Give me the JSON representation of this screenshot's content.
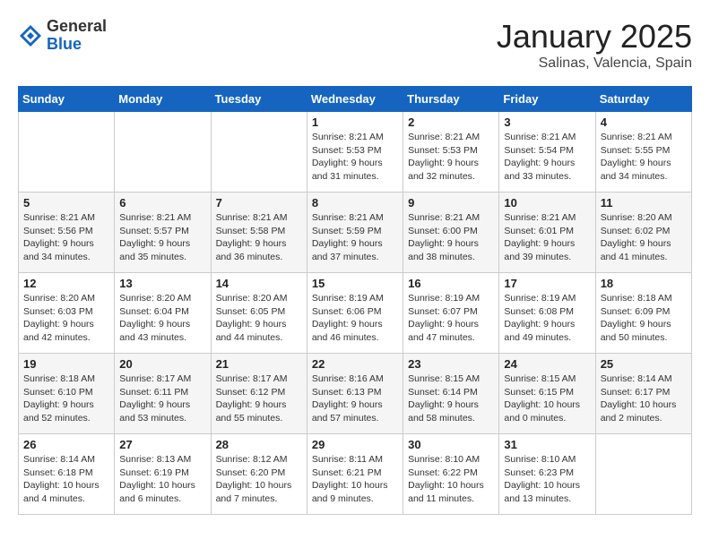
{
  "logo": {
    "general": "General",
    "blue": "Blue"
  },
  "title": "January 2025",
  "subtitle": "Salinas, Valencia, Spain",
  "days_of_week": [
    "Sunday",
    "Monday",
    "Tuesday",
    "Wednesday",
    "Thursday",
    "Friday",
    "Saturday"
  ],
  "weeks": [
    [
      {
        "day": "",
        "info": ""
      },
      {
        "day": "",
        "info": ""
      },
      {
        "day": "",
        "info": ""
      },
      {
        "day": "1",
        "info": "Sunrise: 8:21 AM\nSunset: 5:53 PM\nDaylight: 9 hours and 31 minutes."
      },
      {
        "day": "2",
        "info": "Sunrise: 8:21 AM\nSunset: 5:53 PM\nDaylight: 9 hours and 32 minutes."
      },
      {
        "day": "3",
        "info": "Sunrise: 8:21 AM\nSunset: 5:54 PM\nDaylight: 9 hours and 33 minutes."
      },
      {
        "day": "4",
        "info": "Sunrise: 8:21 AM\nSunset: 5:55 PM\nDaylight: 9 hours and 34 minutes."
      }
    ],
    [
      {
        "day": "5",
        "info": "Sunrise: 8:21 AM\nSunset: 5:56 PM\nDaylight: 9 hours and 34 minutes."
      },
      {
        "day": "6",
        "info": "Sunrise: 8:21 AM\nSunset: 5:57 PM\nDaylight: 9 hours and 35 minutes."
      },
      {
        "day": "7",
        "info": "Sunrise: 8:21 AM\nSunset: 5:58 PM\nDaylight: 9 hours and 36 minutes."
      },
      {
        "day": "8",
        "info": "Sunrise: 8:21 AM\nSunset: 5:59 PM\nDaylight: 9 hours and 37 minutes."
      },
      {
        "day": "9",
        "info": "Sunrise: 8:21 AM\nSunset: 6:00 PM\nDaylight: 9 hours and 38 minutes."
      },
      {
        "day": "10",
        "info": "Sunrise: 8:21 AM\nSunset: 6:01 PM\nDaylight: 9 hours and 39 minutes."
      },
      {
        "day": "11",
        "info": "Sunrise: 8:20 AM\nSunset: 6:02 PM\nDaylight: 9 hours and 41 minutes."
      }
    ],
    [
      {
        "day": "12",
        "info": "Sunrise: 8:20 AM\nSunset: 6:03 PM\nDaylight: 9 hours and 42 minutes."
      },
      {
        "day": "13",
        "info": "Sunrise: 8:20 AM\nSunset: 6:04 PM\nDaylight: 9 hours and 43 minutes."
      },
      {
        "day": "14",
        "info": "Sunrise: 8:20 AM\nSunset: 6:05 PM\nDaylight: 9 hours and 44 minutes."
      },
      {
        "day": "15",
        "info": "Sunrise: 8:19 AM\nSunset: 6:06 PM\nDaylight: 9 hours and 46 minutes."
      },
      {
        "day": "16",
        "info": "Sunrise: 8:19 AM\nSunset: 6:07 PM\nDaylight: 9 hours and 47 minutes."
      },
      {
        "day": "17",
        "info": "Sunrise: 8:19 AM\nSunset: 6:08 PM\nDaylight: 9 hours and 49 minutes."
      },
      {
        "day": "18",
        "info": "Sunrise: 8:18 AM\nSunset: 6:09 PM\nDaylight: 9 hours and 50 minutes."
      }
    ],
    [
      {
        "day": "19",
        "info": "Sunrise: 8:18 AM\nSunset: 6:10 PM\nDaylight: 9 hours and 52 minutes."
      },
      {
        "day": "20",
        "info": "Sunrise: 8:17 AM\nSunset: 6:11 PM\nDaylight: 9 hours and 53 minutes."
      },
      {
        "day": "21",
        "info": "Sunrise: 8:17 AM\nSunset: 6:12 PM\nDaylight: 9 hours and 55 minutes."
      },
      {
        "day": "22",
        "info": "Sunrise: 8:16 AM\nSunset: 6:13 PM\nDaylight: 9 hours and 57 minutes."
      },
      {
        "day": "23",
        "info": "Sunrise: 8:15 AM\nSunset: 6:14 PM\nDaylight: 9 hours and 58 minutes."
      },
      {
        "day": "24",
        "info": "Sunrise: 8:15 AM\nSunset: 6:15 PM\nDaylight: 10 hours and 0 minutes."
      },
      {
        "day": "25",
        "info": "Sunrise: 8:14 AM\nSunset: 6:17 PM\nDaylight: 10 hours and 2 minutes."
      }
    ],
    [
      {
        "day": "26",
        "info": "Sunrise: 8:14 AM\nSunset: 6:18 PM\nDaylight: 10 hours and 4 minutes."
      },
      {
        "day": "27",
        "info": "Sunrise: 8:13 AM\nSunset: 6:19 PM\nDaylight: 10 hours and 6 minutes."
      },
      {
        "day": "28",
        "info": "Sunrise: 8:12 AM\nSunset: 6:20 PM\nDaylight: 10 hours and 7 minutes."
      },
      {
        "day": "29",
        "info": "Sunrise: 8:11 AM\nSunset: 6:21 PM\nDaylight: 10 hours and 9 minutes."
      },
      {
        "day": "30",
        "info": "Sunrise: 8:10 AM\nSunset: 6:22 PM\nDaylight: 10 hours and 11 minutes."
      },
      {
        "day": "31",
        "info": "Sunrise: 8:10 AM\nSunset: 6:23 PM\nDaylight: 10 hours and 13 minutes."
      },
      {
        "day": "",
        "info": ""
      }
    ]
  ]
}
